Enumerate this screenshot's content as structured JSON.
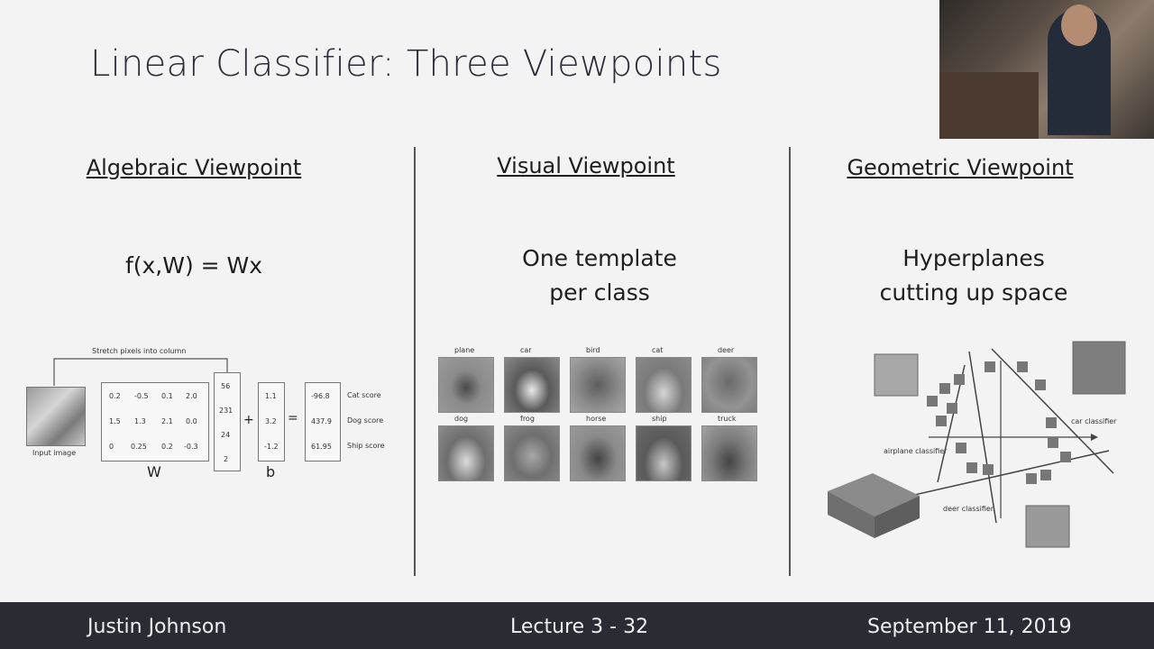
{
  "slide": {
    "title": "Linear Classifier: Three Viewpoints"
  },
  "algebraic": {
    "heading": "Algebraic Viewpoint",
    "formula": "f(x,W) = Wx",
    "stretch_label": "Stretch pixels into column",
    "input_label": "Input image",
    "W_label": "W",
    "b_label": "b",
    "plus": "+",
    "equals": "=",
    "matrix": [
      [
        "0.2",
        "-0.5",
        "0.1",
        "2.0"
      ],
      [
        "1.5",
        "1.3",
        "2.1",
        "0.0"
      ],
      [
        "0",
        "0.25",
        "0.2",
        "-0.3"
      ]
    ],
    "x_col": [
      "56",
      "231",
      "24",
      "2"
    ],
    "b_col": [
      "1.1",
      "3.2",
      "-1.2"
    ],
    "scores": [
      "-96.8",
      "437.9",
      "61.95"
    ],
    "score_labels": [
      "Cat score",
      "Dog score",
      "Ship score"
    ]
  },
  "visual": {
    "heading": "Visual Viewpoint",
    "line1": "One template",
    "line2": "per class",
    "classes": [
      "plane",
      "car",
      "bird",
      "cat",
      "deer",
      "dog",
      "frog",
      "horse",
      "ship",
      "truck"
    ]
  },
  "geometric": {
    "heading": "Geometric Viewpoint",
    "line1": "Hyperplanes",
    "line2": "cutting up space",
    "airplane_label": "airplane classifier",
    "car_label": "car classifier",
    "deer_label": "deer classifier"
  },
  "footer": {
    "author": "Justin Johnson",
    "lecture": "Lecture 3 - 32",
    "date": "September 11, 2019"
  },
  "colors": {
    "footer_bg": "#2b2b34",
    "slide_bg": "#f3f3f3"
  }
}
